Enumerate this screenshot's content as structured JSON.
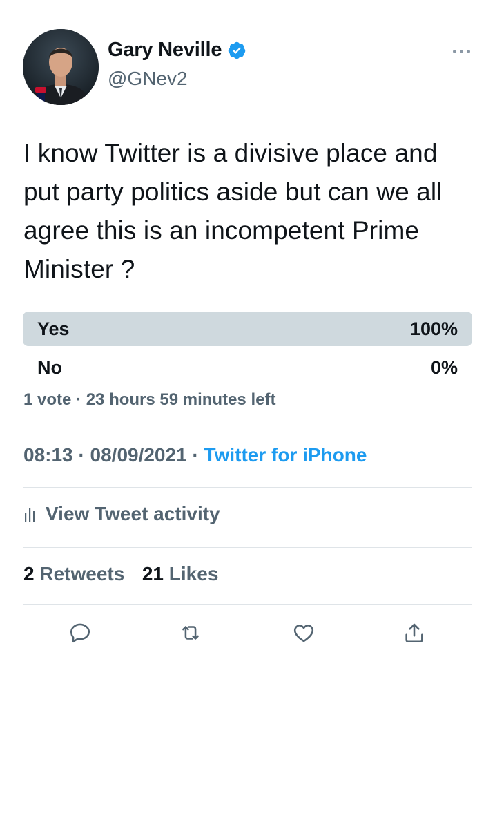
{
  "author": {
    "display_name": "Gary Neville",
    "handle": "@GNev2",
    "verified_icon": "verified-badge-icon",
    "verified_color": "#1d9bf0"
  },
  "tweet": {
    "text": "I know Twitter is a divisive place and put party politics aside but can we all agree this is an incompetent Prime Minister ?"
  },
  "poll": {
    "options": [
      {
        "label": "Yes",
        "percent": "100%",
        "fraction": 1.0
      },
      {
        "label": "No",
        "percent": "0%",
        "fraction": 0.0
      }
    ],
    "votes": "1 vote",
    "separator": " · ",
    "time_left": "23 hours 59 minutes left"
  },
  "meta": {
    "time": "08:13",
    "date": "08/09/2021",
    "separator": " · ",
    "source": "Twitter for iPhone",
    "link_color": "#1d9bf0"
  },
  "activity": {
    "label": "View Tweet activity",
    "icon": "bar-chart-icon"
  },
  "stats": {
    "retweets_count": "2",
    "retweets_label": "Retweets",
    "likes_count": "21",
    "likes_label": "Likes"
  },
  "actions": {
    "reply_icon": "reply-icon",
    "retweet_icon": "retweet-icon",
    "like_icon": "heart-icon",
    "share_icon": "share-icon"
  },
  "colors": {
    "text_primary": "#0f1419",
    "text_secondary": "#536471",
    "poll_bar": "#cfd9de",
    "accent": "#1d9bf0"
  }
}
